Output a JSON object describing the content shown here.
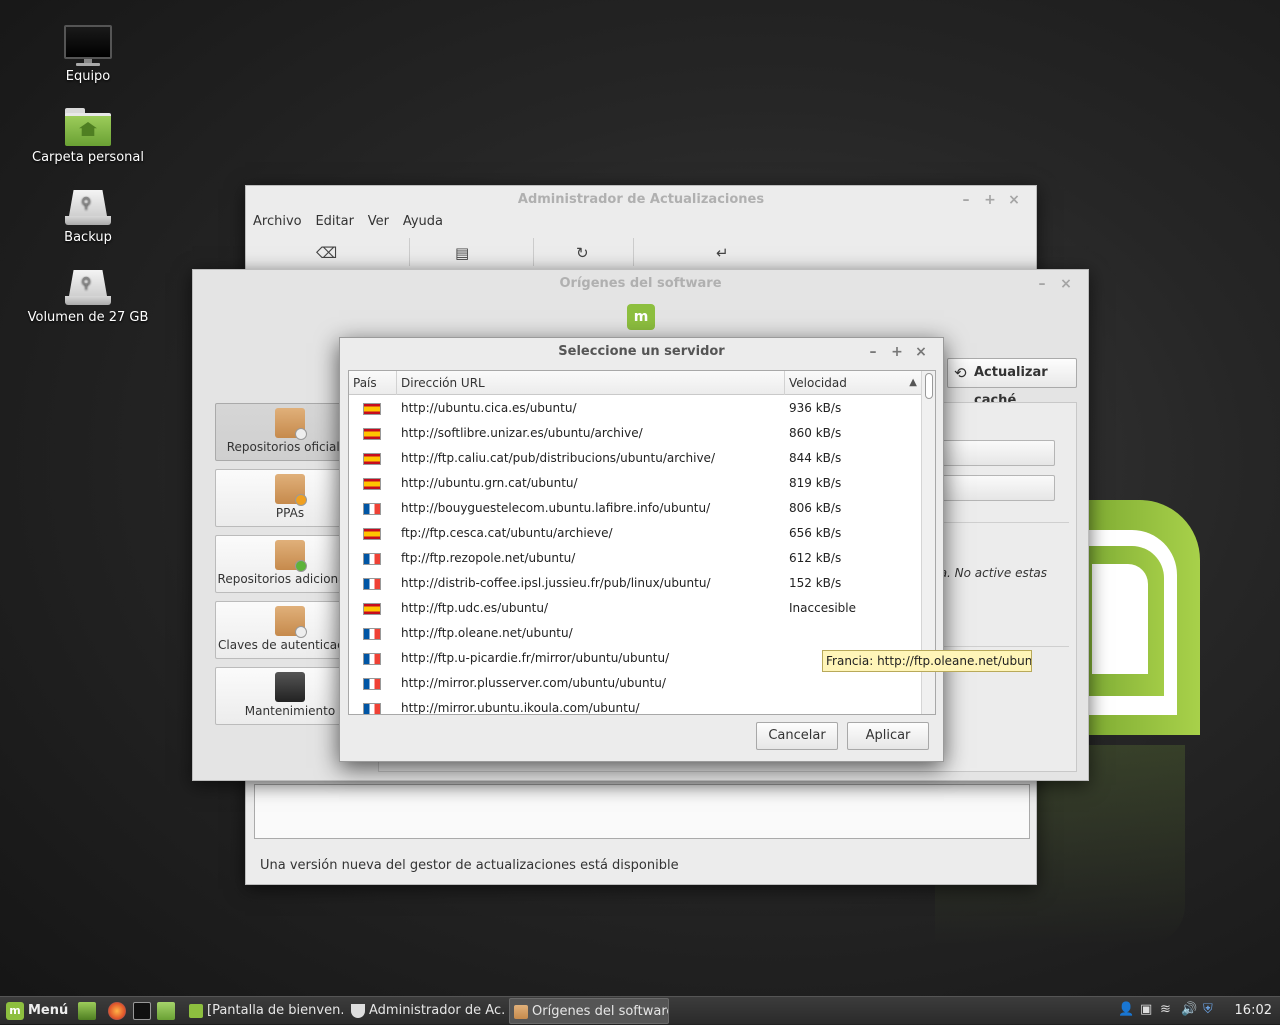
{
  "desktop": {
    "icons": [
      {
        "label": "Equipo",
        "icon": "computer-icon"
      },
      {
        "label": "Carpeta personal",
        "icon": "home-folder-icon"
      },
      {
        "label": "Backup",
        "icon": "usb-drive-icon"
      },
      {
        "label": "Volumen de 27 GB",
        "icon": "usb-drive-icon"
      }
    ]
  },
  "update_manager": {
    "title": "Administrador de Actualizaciones",
    "window_controls": [
      "–",
      "+",
      "×"
    ],
    "menu": [
      "Archivo",
      "Editar",
      "Ver",
      "Ayuda"
    ],
    "toolbar_icons": [
      "clear-icon",
      "changelog-icon",
      "refresh-icon",
      "install-icon"
    ],
    "status": "Una versión nueva del gestor de actualizaciones está disponible"
  },
  "sources": {
    "title": "Orígenes del software",
    "window_controls": [
      "–",
      "×"
    ],
    "logo_text": "m",
    "update_cache_label": "Actualizar caché",
    "sidebar": [
      {
        "label": "Repositorios oficiales",
        "active": true
      },
      {
        "label": "PPAs",
        "active": false
      },
      {
        "label": "Repositorios adicionales",
        "active": false
      },
      {
        "label": "Claves de autenticación",
        "active": false
      },
      {
        "label": "Mantenimiento",
        "active": false
      }
    ],
    "warning_text": "ma. No active estas"
  },
  "server_dialog": {
    "title": "Seleccione un servidor",
    "window_controls": [
      "–",
      "+",
      "×"
    ],
    "columns": {
      "country": "País",
      "url": "Dirección URL",
      "speed": "Velocidad",
      "sort_indicator": "▲"
    },
    "rows": [
      {
        "flag": "es",
        "url": "http://ubuntu.cica.es/ubuntu/",
        "speed": "936 kB/s"
      },
      {
        "flag": "es",
        "url": "http://softlibre.unizar.es/ubuntu/archive/",
        "speed": "860 kB/s"
      },
      {
        "flag": "es",
        "url": "http://ftp.caliu.cat/pub/distribucions/ubuntu/archive/",
        "speed": "844 kB/s"
      },
      {
        "flag": "es",
        "url": "http://ubuntu.grn.cat/ubuntu/",
        "speed": "819 kB/s"
      },
      {
        "flag": "fr",
        "url": "http://bouyguestelecom.ubuntu.lafibre.info/ubuntu/",
        "speed": "806 kB/s"
      },
      {
        "flag": "es",
        "url": "ftp://ftp.cesca.cat/ubuntu/archieve/",
        "speed": "656 kB/s"
      },
      {
        "flag": "fr",
        "url": "ftp://ftp.rezopole.net/ubuntu/",
        "speed": "612 kB/s"
      },
      {
        "flag": "fr",
        "url": "http://distrib-coffee.ipsl.jussieu.fr/pub/linux/ubuntu/",
        "speed": "152 kB/s"
      },
      {
        "flag": "es",
        "url": "http://ftp.udc.es/ubuntu/",
        "speed": "Inaccesible"
      },
      {
        "flag": "fr",
        "url": "http://ftp.oleane.net/ubuntu/",
        "speed": ""
      },
      {
        "flag": "fr",
        "url": "http://ftp.u-picardie.fr/mirror/ubuntu/ubuntu/",
        "speed": ""
      },
      {
        "flag": "fr",
        "url": "http://mirror.plusserver.com/ubuntu/ubuntu/",
        "speed": ""
      },
      {
        "flag": "fr",
        "url": "http://mirror.ubuntu.ikoula.com/ubuntu/",
        "speed": ""
      }
    ],
    "tooltip": "Francia: http://ftp.oleane.net/ubuntu/",
    "cancel_label": "Cancelar",
    "apply_label": "Aplicar"
  },
  "taskbar": {
    "menu_label": "Menú",
    "tasks": [
      {
        "label": "[Pantalla de bienven...",
        "active": false
      },
      {
        "label": "Administrador de Ac...",
        "active": false
      },
      {
        "label": "Orígenes del software",
        "active": true
      }
    ],
    "clock": "16:02"
  },
  "colors": {
    "mint_green": "#8dbf3f",
    "tooltip_bg": "#fff5b8",
    "taskbar_bg": "#2f2f2f"
  }
}
